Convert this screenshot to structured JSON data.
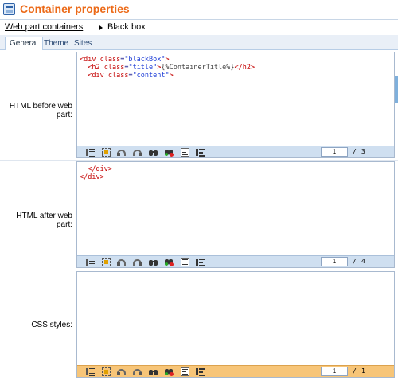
{
  "header": {
    "title": "Container properties",
    "icon": "container-icon"
  },
  "breadcrumb": {
    "link_label": "Web part containers",
    "current_label": "Black box"
  },
  "tabs": [
    {
      "label": "General",
      "active": true
    },
    {
      "label": "Theme",
      "active": false
    },
    {
      "label": "Sites",
      "active": false
    }
  ],
  "fields": {
    "before": {
      "label": "HTML before web part:",
      "page": "1",
      "separator": "/",
      "total": "3"
    },
    "after": {
      "label": "HTML after web part:",
      "page": "1",
      "separator": "/",
      "total": "4"
    },
    "css": {
      "label": "CSS styles:",
      "page": "1",
      "separator": "/",
      "total": "1"
    }
  },
  "code_before": {
    "l1_open": "<div ",
    "l1_attr": "class",
    "l1_eq": "=",
    "l1_str": "\"blackBox\"",
    "l1_close": ">",
    "l2_indent": "  ",
    "l2_open": "<h2 ",
    "l2_attr": "class",
    "l2_eq": "=",
    "l2_str": "\"title\"",
    "l2_gt": ">",
    "l2_macro": "{%ContainerTitle%}",
    "l2_end": "</h2>",
    "l3_indent": "  ",
    "l3_open": "<div ",
    "l3_attr": "class",
    "l3_eq": "=",
    "l3_str": "\"content\"",
    "l3_close": ">"
  },
  "code_after": {
    "l1": "  </div>",
    "l2": "</div>"
  },
  "toolbar_icons": [
    "line-numbers-icon",
    "select-all-icon",
    "undo-icon",
    "redo-icon",
    "find-icon",
    "replace-icon",
    "format-icon",
    "indent-icon"
  ],
  "colors": {
    "title_orange": "#ec6a18",
    "toolbar_blue": "#cfdff0",
    "toolbar_orange": "#f7c578"
  }
}
